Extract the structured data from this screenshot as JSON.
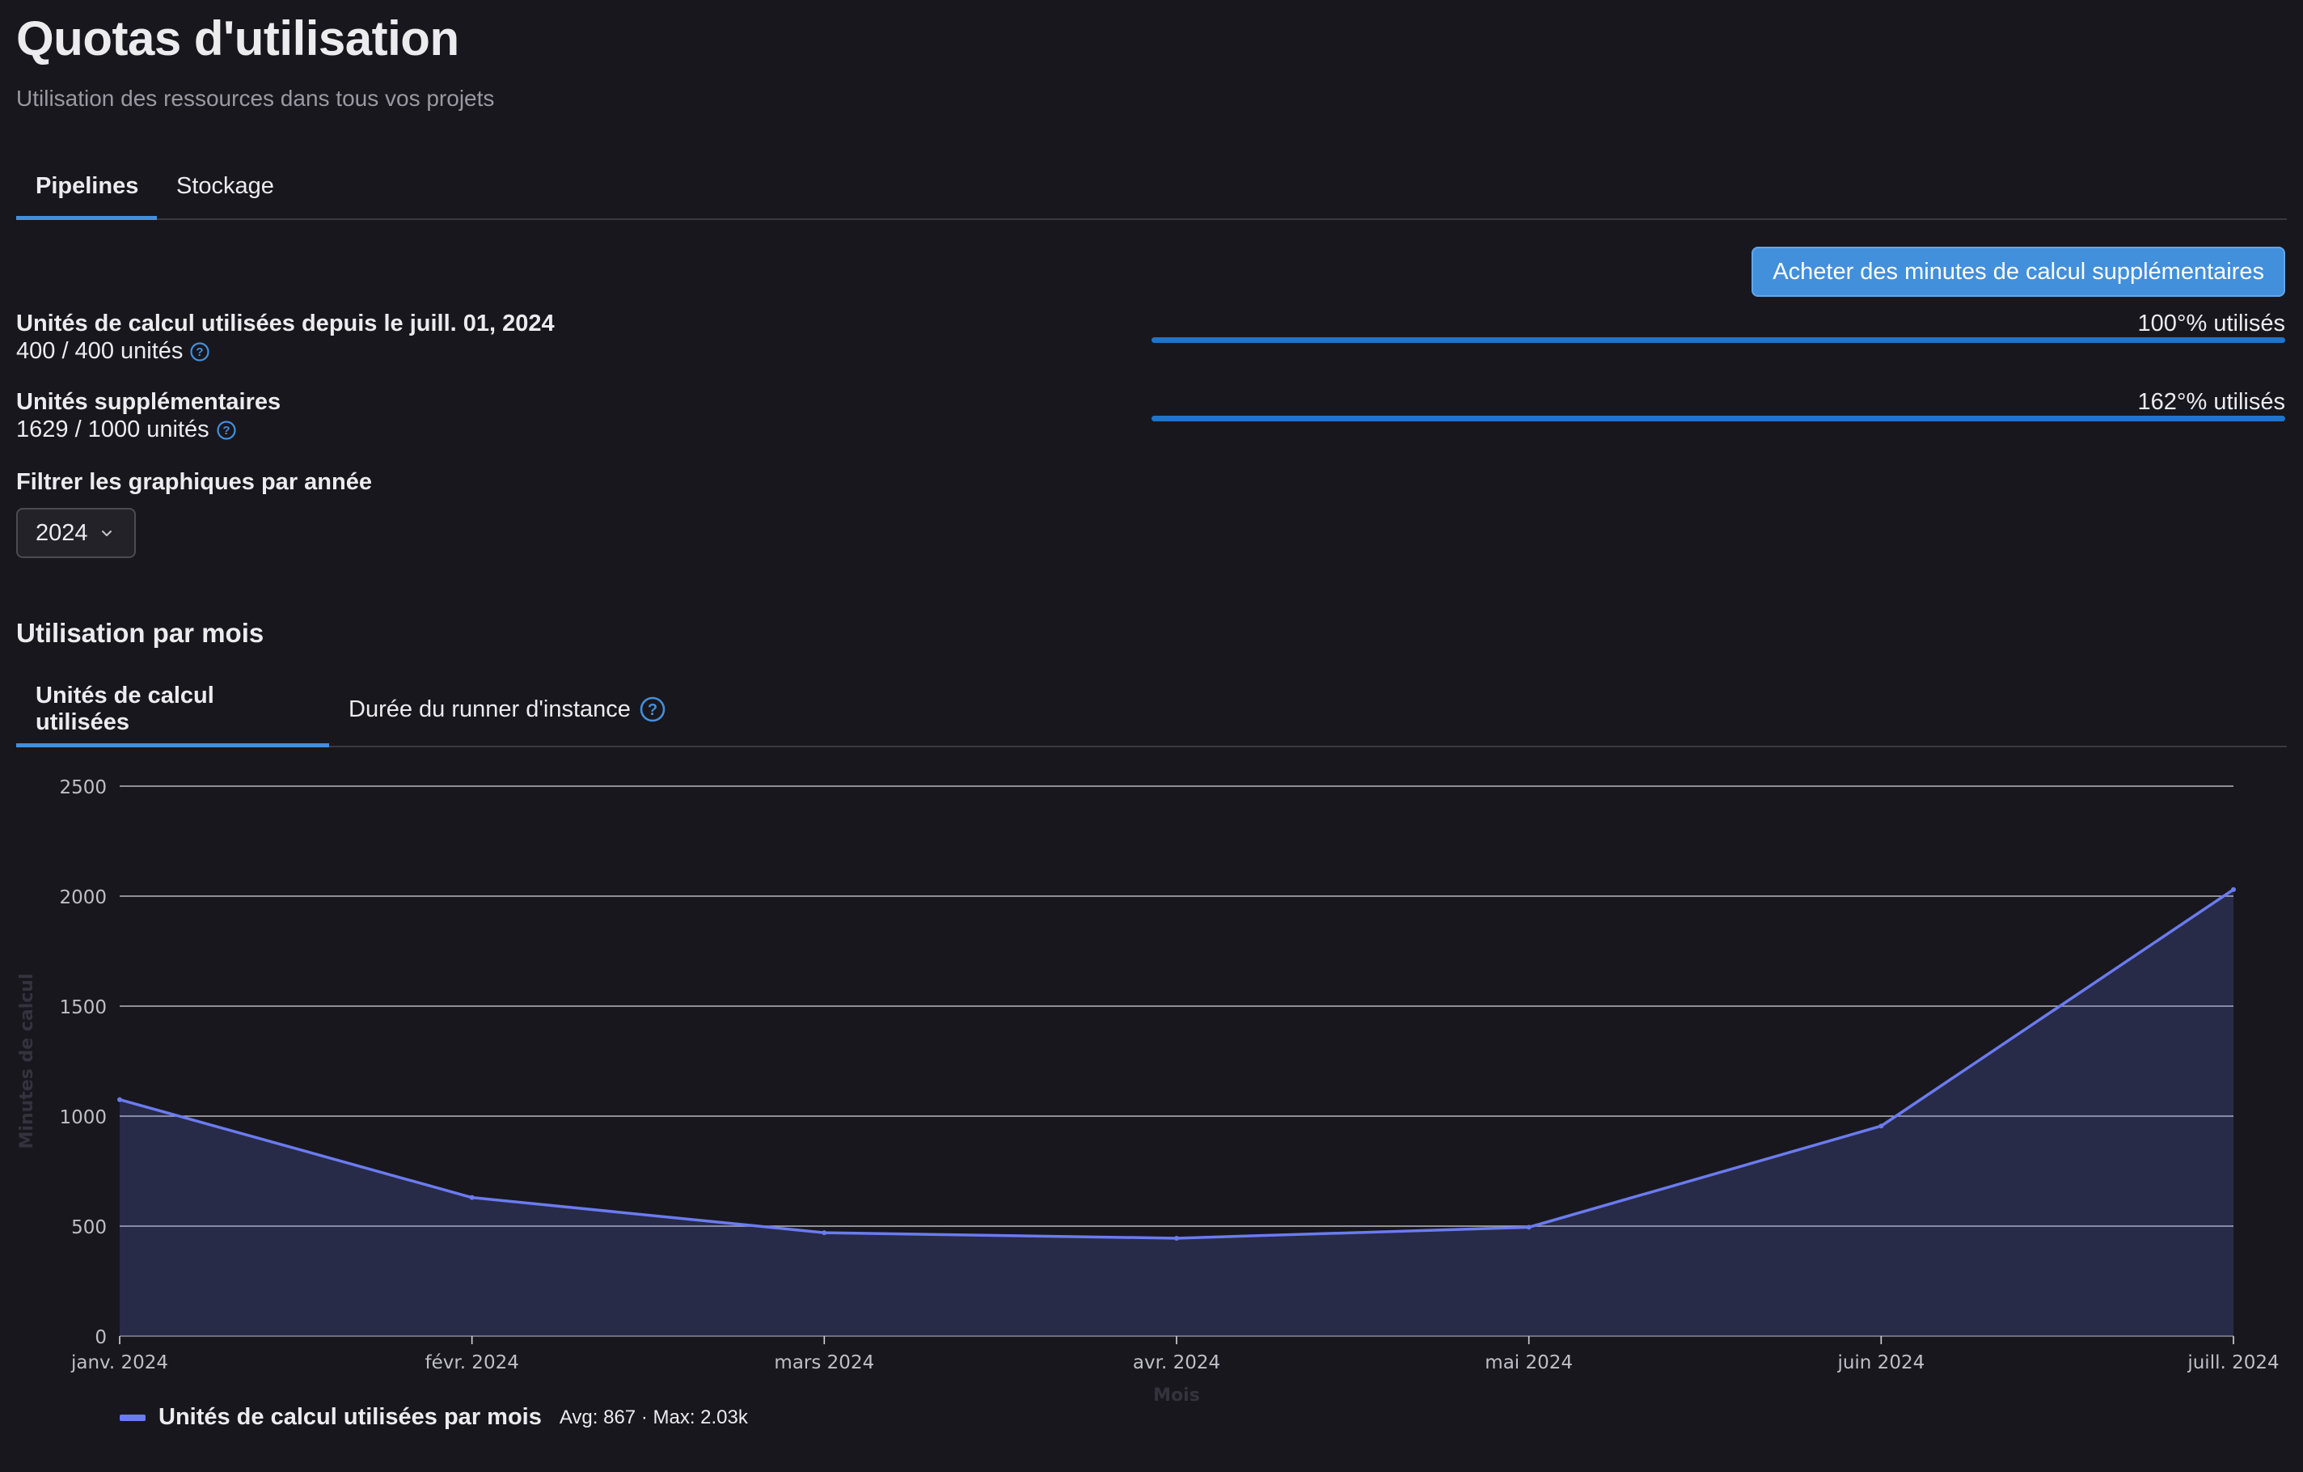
{
  "page": {
    "title": "Quotas d'utilisation",
    "subtitle": "Utilisation des ressources dans tous vos projets"
  },
  "tabs": [
    {
      "label": "Pipelines",
      "active": true
    },
    {
      "label": "Stockage",
      "active": false
    }
  ],
  "buy_button": {
    "label": "Acheter des minutes de calcul supplémentaires"
  },
  "usage": [
    {
      "label": "Unités de calcul utilisées depuis le juill. 01, 2024",
      "value": "400 / 400 unités",
      "percent_text": "100°% utilisés",
      "fill_fraction": 1.0
    },
    {
      "label": "Unités supplémentaires",
      "value": "1629 / 1000 unités",
      "percent_text": "162°% utilisés",
      "fill_fraction": 1.0
    }
  ],
  "filter": {
    "label": "Filtrer les graphiques par année",
    "selected": "2024"
  },
  "section_title": "Utilisation par mois",
  "chart_tabs": [
    {
      "label": "Unités de calcul utilisées",
      "active": true
    },
    {
      "label": "Durée du runner d'instance",
      "active": false
    }
  ],
  "colors": {
    "accent": "#428fdc",
    "series": "#6b7bf0",
    "background": "#18171d"
  },
  "chart_data": {
    "type": "area",
    "categories": [
      "janv. 2024",
      "févr. 2024",
      "mars 2024",
      "avr. 2024",
      "mai 2024",
      "juin 2024",
      "juill. 2024"
    ],
    "series": [
      {
        "name": "Unités de calcul utilisées par mois",
        "values": [
          1075,
          630,
          470,
          445,
          495,
          955,
          2030
        ]
      }
    ],
    "ylabel": "Minutes de calcul",
    "xlabel": "Mois",
    "ylim": [
      0,
      2500
    ],
    "yticks": [
      "0",
      "500",
      "1000",
      "1500",
      "2000",
      "2500"
    ],
    "grid": true,
    "legend": {
      "position": "bottom-left",
      "stats": "Avg: 867 · Max: 2.03k"
    }
  }
}
